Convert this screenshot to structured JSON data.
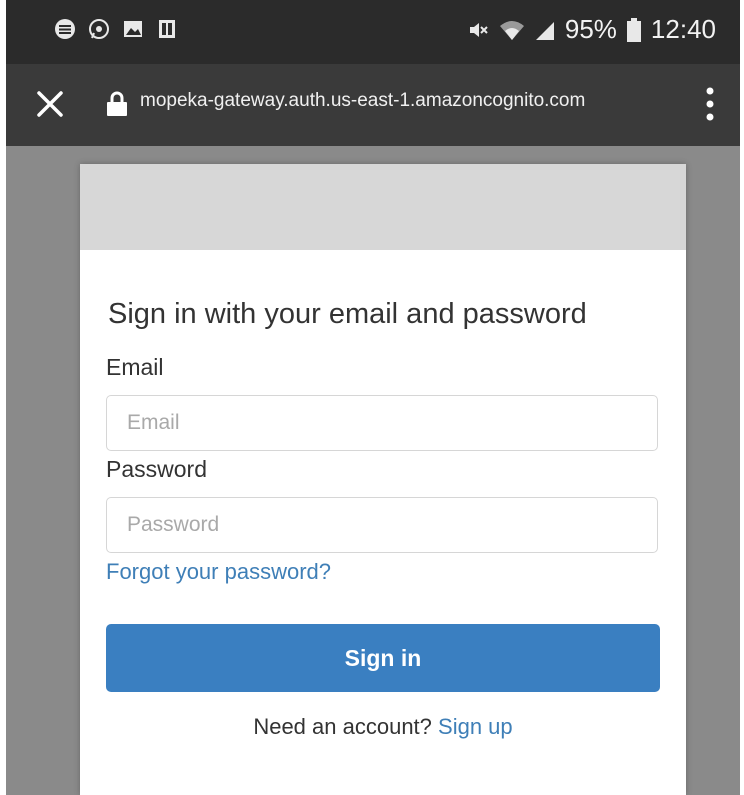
{
  "status_bar": {
    "icons": [
      "signal-icon",
      "whatsapp-icon",
      "image-icon",
      "notification-icon"
    ],
    "battery": "95%",
    "time": "12:40"
  },
  "url_bar": {
    "url": "mopeka-gateway.auth.us-east-1.amazoncognito.com"
  },
  "signin": {
    "heading": "Sign in with your email and password",
    "email_label": "Email",
    "email_placeholder": "Email",
    "password_label": "Password",
    "password_placeholder": "Password",
    "forgot_link": "Forgot your password?",
    "button_label": "Sign in",
    "need_account": "Need an account?",
    "signup_link": "Sign up"
  },
  "colors": {
    "accent": "#3a7fc1",
    "link": "#3f7fb7",
    "status_bar_bg": "#2b2b2b",
    "url_bar_bg": "#3a3a3a"
  }
}
